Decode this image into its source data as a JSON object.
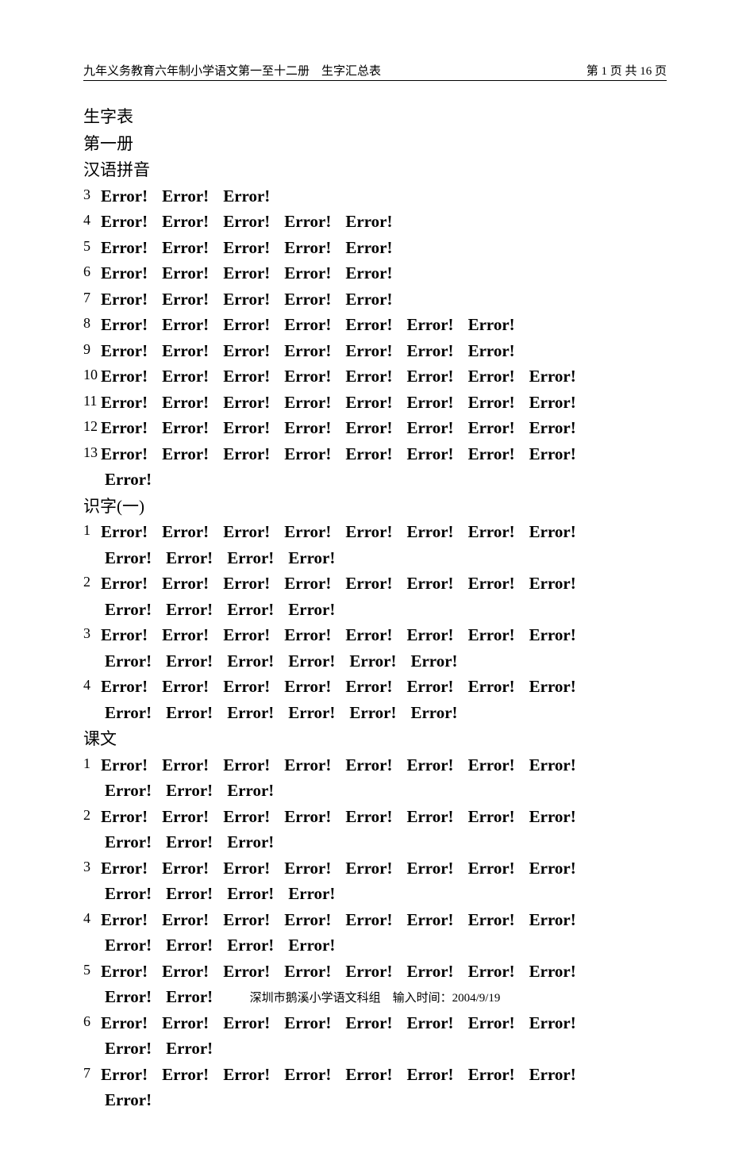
{
  "header": {
    "left": "九年义务教育六年制小学语文第一至十二册　生字汇总表",
    "right_prefix": "第 ",
    "right_page": "1",
    "right_mid": " 页 共 ",
    "right_total": "16",
    "right_suffix": " 页"
  },
  "headings": {
    "h1": "生字表",
    "h2": "第一册",
    "h3": "汉语拼音",
    "h4": "识字(一)",
    "h5": "课文"
  },
  "error_word": "Error!",
  "section_pinyin": [
    {
      "n": "3",
      "count": 3,
      "wrap": 0
    },
    {
      "n": "4",
      "count": 5,
      "wrap": 0
    },
    {
      "n": "5",
      "count": 5,
      "wrap": 0
    },
    {
      "n": "6",
      "count": 5,
      "wrap": 0
    },
    {
      "n": "7",
      "count": 5,
      "wrap": 0
    },
    {
      "n": "8",
      "count": 7,
      "wrap": 0
    },
    {
      "n": "9",
      "count": 7,
      "wrap": 0
    },
    {
      "n": "10",
      "count": 8,
      "wrap": 0
    },
    {
      "n": "11",
      "count": 8,
      "wrap": 0
    },
    {
      "n": "12",
      "count": 8,
      "wrap": 0
    },
    {
      "n": "13",
      "count": 9,
      "wrap": 8
    }
  ],
  "section_shizi": [
    {
      "n": "1",
      "count": 12,
      "wrap": 8
    },
    {
      "n": "2",
      "count": 12,
      "wrap": 8
    },
    {
      "n": "3",
      "count": 14,
      "wrap": 8
    },
    {
      "n": "4",
      "count": 14,
      "wrap": 8
    }
  ],
  "section_kewen": [
    {
      "n": "1",
      "count": 11,
      "wrap": 8
    },
    {
      "n": "2",
      "count": 11,
      "wrap": 8
    },
    {
      "n": "3",
      "count": 12,
      "wrap": 8
    },
    {
      "n": "4",
      "count": 12,
      "wrap": 8
    },
    {
      "n": "5",
      "count": 10,
      "wrap": 8
    },
    {
      "n": "6",
      "count": 10,
      "wrap": 8
    },
    {
      "n": "7",
      "count": 9,
      "wrap": 8
    }
  ],
  "footer": {
    "org": "深圳市鹅溪小学语文科组",
    "label": "　输入时间：",
    "date": "2004/9/19"
  }
}
